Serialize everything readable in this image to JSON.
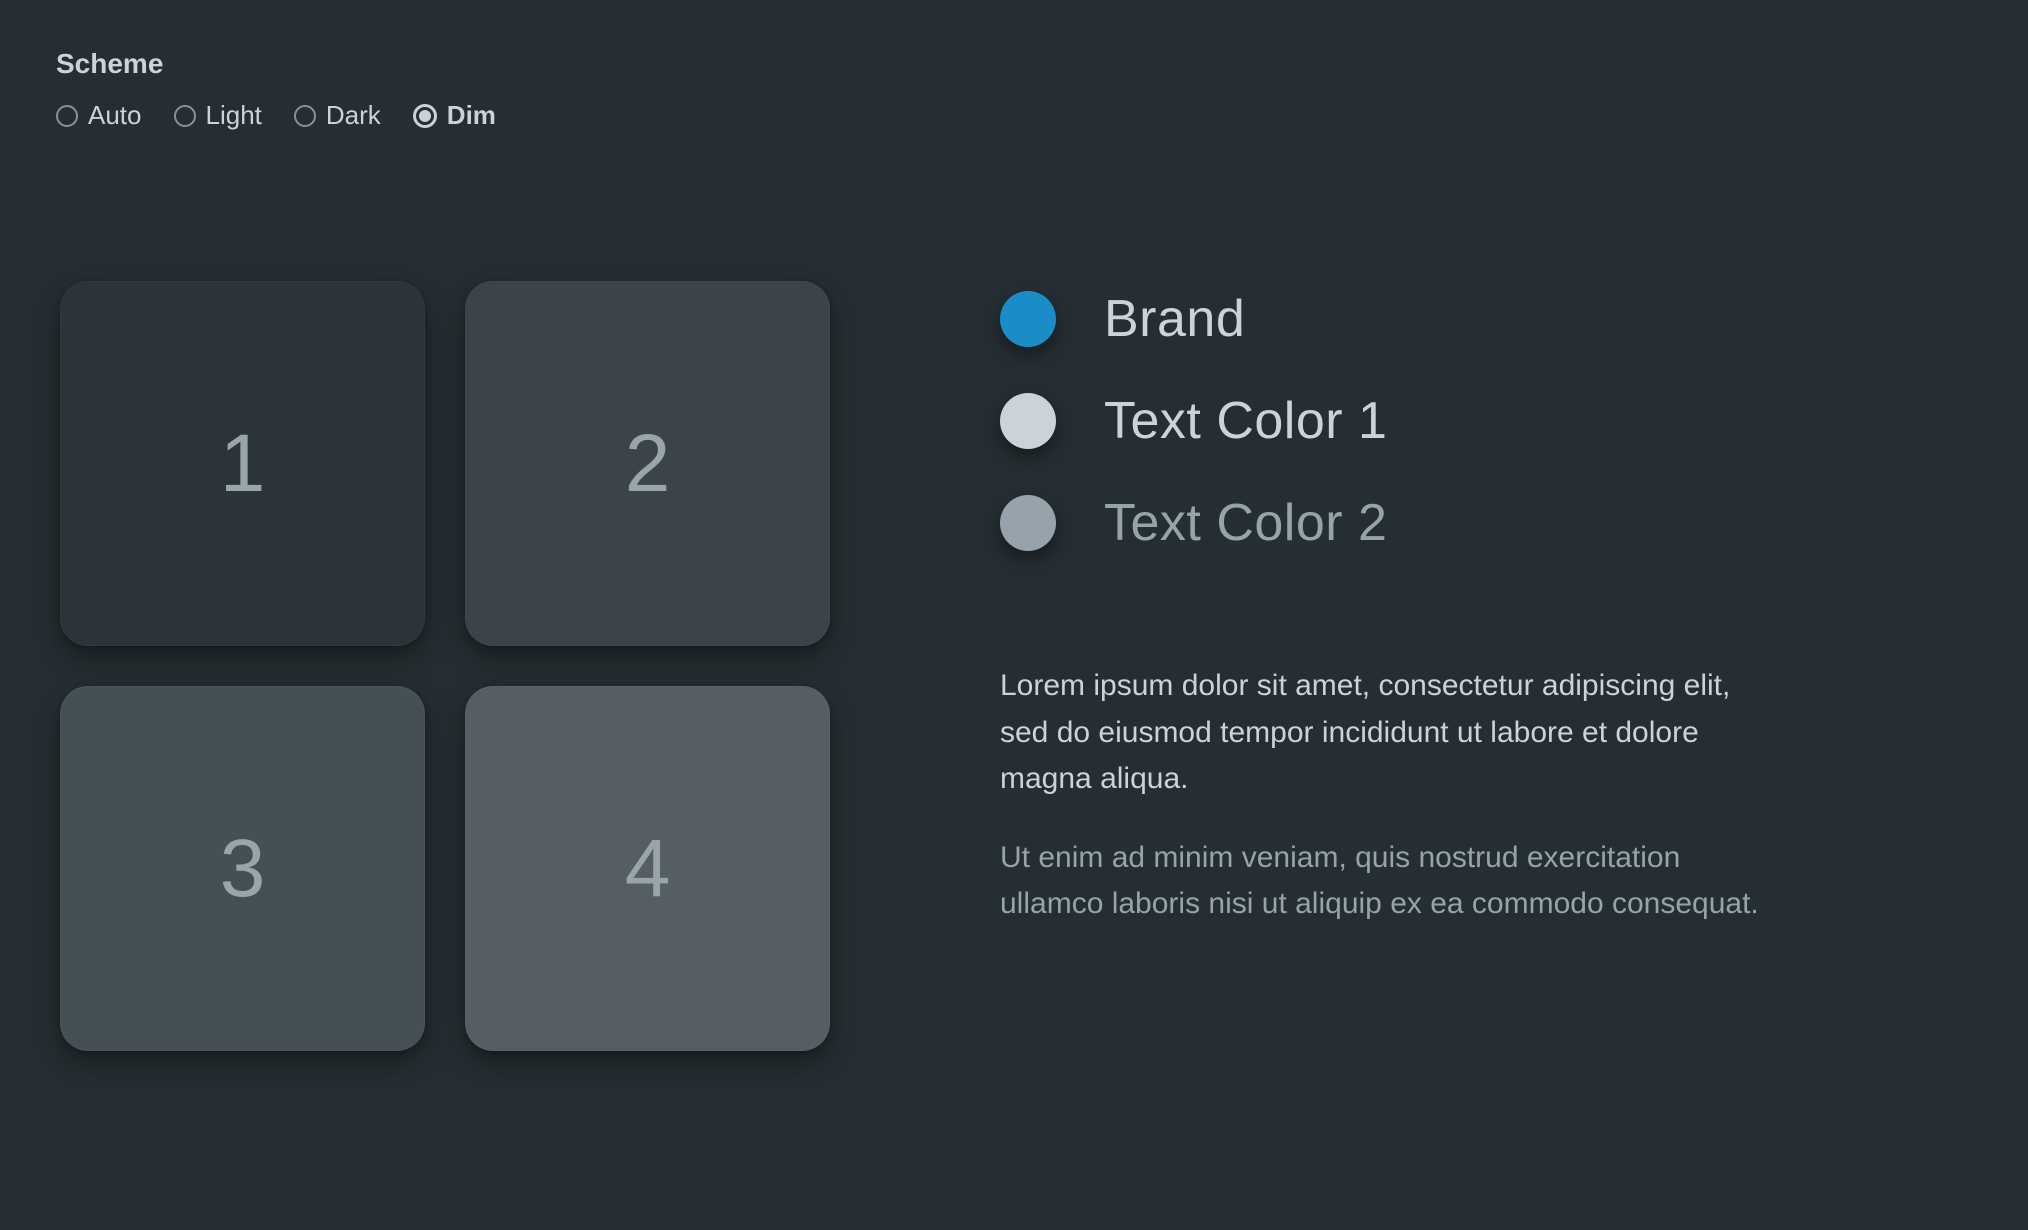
{
  "scheme": {
    "label": "Scheme",
    "options": [
      {
        "label": "Auto",
        "selected": false
      },
      {
        "label": "Light",
        "selected": false
      },
      {
        "label": "Dark",
        "selected": false
      },
      {
        "label": "Dim",
        "selected": true
      }
    ]
  },
  "tiles": {
    "t1": "1",
    "t2": "2",
    "t3": "3",
    "t4": "4"
  },
  "colors": {
    "brand": {
      "label": "Brand",
      "hex": "#1a8cc8"
    },
    "text1": {
      "label": "Text Color 1",
      "hex": "#c9d3d8"
    },
    "text2": {
      "label": "Text Color 2",
      "hex": "#97a3aa"
    }
  },
  "paragraphs": {
    "p1": "Lorem ipsum dolor sit amet, consectetur adipiscing elit, sed do eiusmod tempor incididunt ut labore et dolore magna aliqua.",
    "p2": "Ut enim ad minim veniam, quis nostrud exercitation ullamco laboris nisi ut aliquip ex ea commodo consequat."
  }
}
